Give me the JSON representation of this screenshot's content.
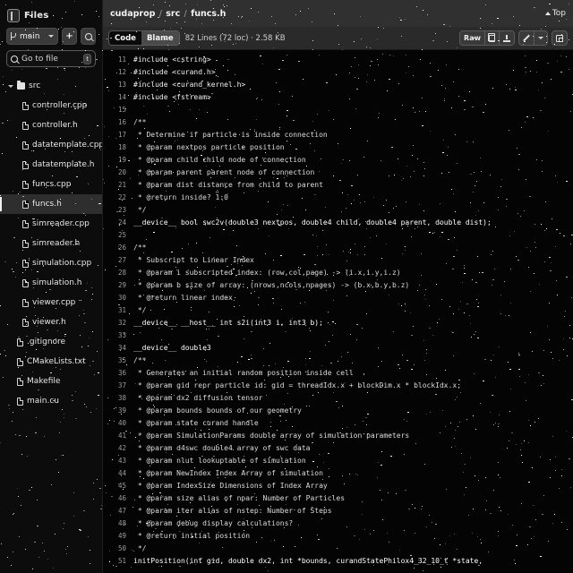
{
  "sidebar": {
    "files_label": "Files",
    "files_icon": "panel-icon",
    "branch": {
      "name": "main",
      "icon": "git-branch-icon",
      "chevron": "chevron-down-icon"
    },
    "add_button_label": "+",
    "search_icon": "search-icon",
    "gotofile": {
      "placeholder": "Go to file",
      "shortcut": "t",
      "icon": "search-icon"
    },
    "tree": [
      {
        "label": "src",
        "type": "folder",
        "indent": 0,
        "expanded": true,
        "selected": false
      },
      {
        "label": "controller.cpp",
        "type": "file",
        "indent": 1,
        "selected": false
      },
      {
        "label": "controller.h",
        "type": "file",
        "indent": 1,
        "selected": false
      },
      {
        "label": "datatemplate.cpp",
        "type": "file",
        "indent": 1,
        "selected": false
      },
      {
        "label": "datatemplate.h",
        "type": "file",
        "indent": 1,
        "selected": false
      },
      {
        "label": "funcs.cpp",
        "type": "file",
        "indent": 1,
        "selected": false
      },
      {
        "label": "funcs.h",
        "type": "file",
        "indent": 1,
        "selected": true
      },
      {
        "label": "simreader.cpp",
        "type": "file",
        "indent": 1,
        "selected": false
      },
      {
        "label": "simreader.h",
        "type": "file",
        "indent": 1,
        "selected": false
      },
      {
        "label": "simulation.cpp",
        "type": "file",
        "indent": 1,
        "selected": false
      },
      {
        "label": "simulation.h",
        "type": "file",
        "indent": 1,
        "selected": false
      },
      {
        "label": "viewer.cpp",
        "type": "file",
        "indent": 1,
        "selected": false
      },
      {
        "label": "viewer.h",
        "type": "file",
        "indent": 1,
        "selected": false
      },
      {
        "label": ".gitignore",
        "type": "file",
        "indent": 0,
        "selected": false
      },
      {
        "label": "CMakeLists.txt",
        "type": "file",
        "indent": 0,
        "selected": false
      },
      {
        "label": "Makefile",
        "type": "file",
        "indent": 0,
        "selected": false
      },
      {
        "label": "main.cu",
        "type": "file",
        "indent": 0,
        "selected": false
      }
    ]
  },
  "header": {
    "breadcrumb": {
      "repo": "cudaprop",
      "folder": "src",
      "file": "funcs.h",
      "separator": "/"
    },
    "top_link": "Top",
    "top_icon": "arrow-up-icon"
  },
  "toolbar": {
    "tab_code": "Code",
    "tab_blame": "Blame",
    "file_meta": "82 Lines (72 loc) · 2.58 KB",
    "raw_label": "Raw",
    "copy_icon": "copy-icon",
    "download_icon": "download-icon",
    "edit_icon": "pencil-icon",
    "edit_chevron": "chevron-down-icon",
    "expand_icon": "expand-icon"
  },
  "code": {
    "lines": [
      {
        "n": "11",
        "t": "#include <cstring>",
        "k": "pre"
      },
      {
        "n": "12",
        "t": "#include <curand.h>",
        "k": "pre"
      },
      {
        "n": "13",
        "t": "#include <curand_kernel.h>",
        "k": "pre"
      },
      {
        "n": "14",
        "t": "#include <fstream>",
        "k": "pre"
      },
      {
        "n": "15",
        "t": "",
        "k": ""
      },
      {
        "n": "16",
        "t": "/**",
        "k": "cmt"
      },
      {
        "n": "17",
        "t": " * Determine if particle is inside connection",
        "k": "cmt"
      },
      {
        "n": "18",
        "t": " * @param nextpos particle position",
        "k": "cmt"
      },
      {
        "n": "19",
        "t": " * @param child child node of connection",
        "k": "cmt"
      },
      {
        "n": "20",
        "t": " * @param parent parent node of connection",
        "k": "cmt"
      },
      {
        "n": "21",
        "t": " * @param dist distance from child to parent",
        "k": "cmt"
      },
      {
        "n": "22",
        "t": " * @return inside? 1:0",
        "k": "cmt"
      },
      {
        "n": "23",
        "t": " */",
        "k": "cmt"
      },
      {
        "n": "24",
        "t": "__device__ bool swc2v(double3 nextpos, double4 child, double4 parent, double dist);",
        "k": "decl"
      },
      {
        "n": "25",
        "t": "",
        "k": ""
      },
      {
        "n": "26",
        "t": "/**",
        "k": "cmt"
      },
      {
        "n": "27",
        "t": " * Subscript to Linear Index",
        "k": "cmt"
      },
      {
        "n": "28",
        "t": " * @param i subscripted index: (row,col,page) -> (i.x,i.y,i.z)",
        "k": "cmt"
      },
      {
        "n": "29",
        "t": " * @param b size of array: (nrows,ncols,npages) -> (b.x,b.y,b.z)",
        "k": "cmt"
      },
      {
        "n": "30",
        "t": " * @return linear index",
        "k": "cmt"
      },
      {
        "n": "31",
        "t": " */",
        "k": "cmt"
      },
      {
        "n": "32",
        "t": "__device__ __host__ int s2i(int3 i, int3 b);",
        "k": "decl"
      },
      {
        "n": "33",
        "t": "",
        "k": ""
      },
      {
        "n": "34",
        "t": "__device__ double3",
        "k": "decl"
      },
      {
        "n": "35",
        "t": "/**",
        "k": "cmt"
      },
      {
        "n": "36",
        "t": " * Generates an initial random position inside cell",
        "k": "cmt"
      },
      {
        "n": "37",
        "t": " * @param gid repr particle id: gid = threadIdx.x + blockDim.x * blockIdx.x;",
        "k": "cmt"
      },
      {
        "n": "38",
        "t": " * @param dx2 diffusion tensor",
        "k": "cmt"
      },
      {
        "n": "39",
        "t": " * @param bounds bounds of our geometry",
        "k": "cmt"
      },
      {
        "n": "40",
        "t": " * @param state curand handle",
        "k": "cmt"
      },
      {
        "n": "41",
        "t": " * @param SimulationParams double array of simulation parameters",
        "k": "cmt"
      },
      {
        "n": "42",
        "t": " * @param d4swc double4 array of swc data",
        "k": "cmt"
      },
      {
        "n": "43",
        "t": " * @param nlut lookuptable of simulation",
        "k": "cmt"
      },
      {
        "n": "44",
        "t": " * @param NewIndex Index Array of simulation",
        "k": "cmt"
      },
      {
        "n": "45",
        "t": " * @param IndexSize Dimensions of Index Array",
        "k": "cmt"
      },
      {
        "n": "46",
        "t": " * @param size alias of npar: Number of Particles",
        "k": "cmt"
      },
      {
        "n": "47",
        "t": " * @param iter alias of nstep: Number of Steps",
        "k": "cmt"
      },
      {
        "n": "48",
        "t": " * @param debug display calculations?",
        "k": "cmt"
      },
      {
        "n": "49",
        "t": " * @return initial position",
        "k": "cmt"
      },
      {
        "n": "50",
        "t": " */",
        "k": "cmt"
      },
      {
        "n": "51",
        "t": "initPosition(int gid, double dx2, int *bounds, curandStatePhilox4_32_10_t *state,",
        "k": "decl"
      }
    ]
  }
}
